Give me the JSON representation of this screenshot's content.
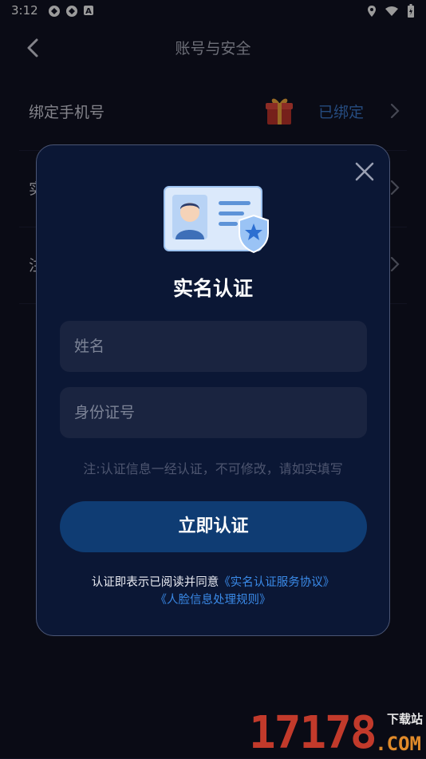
{
  "status_bar": {
    "time": "3:12"
  },
  "header": {
    "title": "账号与安全"
  },
  "rows": [
    {
      "label": "绑定手机号",
      "value": "已绑定"
    },
    {
      "label": "实",
      "value": ""
    },
    {
      "label": "注",
      "value": ""
    }
  ],
  "modal": {
    "title": "实名认证",
    "name_placeholder": "姓名",
    "id_placeholder": "身份证号",
    "note": "注:认证信息一经认证，不可修改，请如实填写",
    "submit_label": "立即认证",
    "agree_prefix": "认证即表示已阅读并同意",
    "agreement_link": "《实名认证服务协议》",
    "face_rules_link": "《人脸信息处理规则》"
  },
  "watermark": {
    "number": "17178",
    "site": "下载站",
    "domain": ".COM"
  },
  "colors": {
    "background": "#101121",
    "modal_bg": "#0b1735",
    "accent": "#3a8ae8",
    "button": "#0f3c73"
  }
}
